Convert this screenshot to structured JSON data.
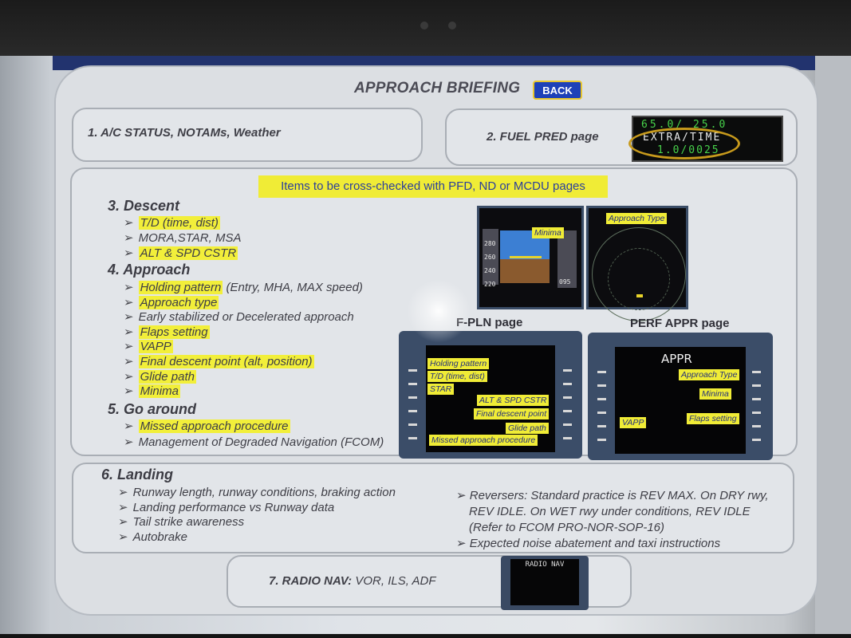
{
  "header": {
    "title": "APPROACH BRIEFING",
    "back_label": "BACK"
  },
  "box1": {
    "label": "1. A/C STATUS, NOTAMs, Weather"
  },
  "box2": {
    "label": "2. FUEL PRED page",
    "fuel_line1": "65.0/ 25.0",
    "fuel_line2": "EXTRA/TIME",
    "fuel_line3": "1.0/0025"
  },
  "banner": "Items to be cross-checked with PFD, ND or MCDU pages",
  "descent": {
    "title": "3. Descent",
    "items": [
      {
        "text": "T/D (time, dist)",
        "hl": true
      },
      {
        "text": "MORA,STAR, MSA",
        "hl": false
      },
      {
        "text": "ALT & SPD CSTR",
        "hl": true
      }
    ]
  },
  "approach": {
    "title": "4. Approach",
    "items": [
      {
        "hltext": "Holding pattern",
        "rest": " (Entry, MHA, MAX speed)"
      },
      {
        "hltext": "Approach type",
        "rest": ""
      },
      {
        "hltext": "",
        "rest": "Early stabilized or Decelerated approach"
      },
      {
        "hltext": "Flaps setting",
        "rest": ""
      },
      {
        "hltext": "VAPP",
        "rest": ""
      },
      {
        "hltext": "Final descent point (alt, position)",
        "rest": ""
      },
      {
        "hltext": "Glide path",
        "rest": ""
      },
      {
        "hltext": "Minima",
        "rest": ""
      }
    ]
  },
  "goaround": {
    "title": "5. Go around",
    "items": [
      {
        "hltext": "Missed approach procedure",
        "rest": ""
      },
      {
        "hltext": "",
        "rest": "Management of Degraded Navigation (FCOM)"
      }
    ]
  },
  "pfd": {
    "tag": "Minima",
    "speeds": [
      "280",
      "260",
      "240",
      "220"
    ],
    "alt": "095"
  },
  "nd": {
    "tag": "Approach Type"
  },
  "fpln": {
    "label": "F-PLN page",
    "tags": [
      "Holding pattern",
      "T/D (time, dist)",
      "STAR",
      "ALT & SPD CSTR",
      "Final descent point",
      "Glide path",
      "Missed approach procedure"
    ]
  },
  "perf": {
    "label": "PERF APPR page",
    "screen_title": "APPR",
    "tags": [
      "Approach Type",
      "Minima",
      "VAPP",
      "Flaps setting"
    ]
  },
  "landing": {
    "title": "6. Landing",
    "left_items": [
      "Runway length, runway conditions, braking action",
      "Landing performance vs Runway data",
      "Tail strike awareness",
      "Autobrake"
    ],
    "right_items": [
      "Reversers: Standard practice is REV MAX. On DRY rwy, REV IDLE. On WET rwy under conditions, REV IDLE (Refer to FCOM PRO-NOR-SOP-16)",
      "Expected noise abatement and taxi instructions"
    ]
  },
  "radio": {
    "label_bold": "7. RADIO NAV:",
    "label_rest": " VOR, ILS, ADF",
    "screen": "RADIO NAV"
  },
  "colors": {
    "highlight": "#f2ef3a",
    "back_button": "#1e41b8",
    "mcdu_frame": "#3b4d68"
  }
}
